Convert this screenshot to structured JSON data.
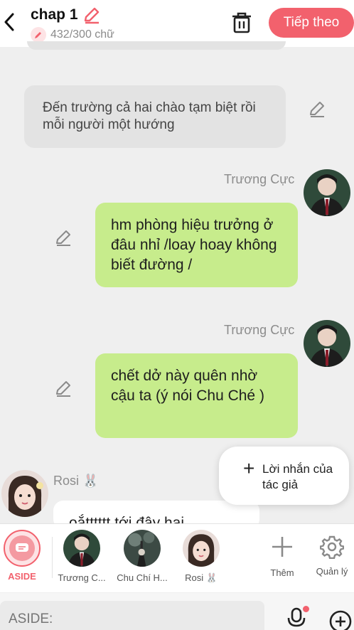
{
  "header": {
    "title": "chap 1",
    "word_count": "432/300 chữ",
    "next_label": "Tiếp theo"
  },
  "narration": {
    "text": "Đến trường cả hai chào tạm biệt rồi mỗi người một hướng"
  },
  "messages": [
    {
      "sender": "Trương Cực",
      "text": "hm phòng hiệu trưởng ở đâu nhỉ /loay hoay không biết đường /"
    },
    {
      "sender": "Trương Cực",
      "text": "chết dở này quên nhờ cậu ta (ý nói Chu Ché )"
    },
    {
      "sender": "Rosi 🐰",
      "text": "oắtttttt tới đây hai"
    }
  ],
  "float_note": {
    "label": "Lời nhắn của tác giả"
  },
  "char_bar": {
    "aside_label": "ASIDE",
    "characters": [
      {
        "label": "Trương C..."
      },
      {
        "label": "Chu Chí H..."
      },
      {
        "label": "Rosi 🐰"
      }
    ],
    "add_label": "Thêm",
    "manage_label": "Quản lý"
  },
  "input": {
    "placeholder": "ASIDE:"
  },
  "colors": {
    "accent": "#f2616d",
    "bubble_green": "#c7ec8c",
    "narration_bg": "#e3e3e3"
  }
}
